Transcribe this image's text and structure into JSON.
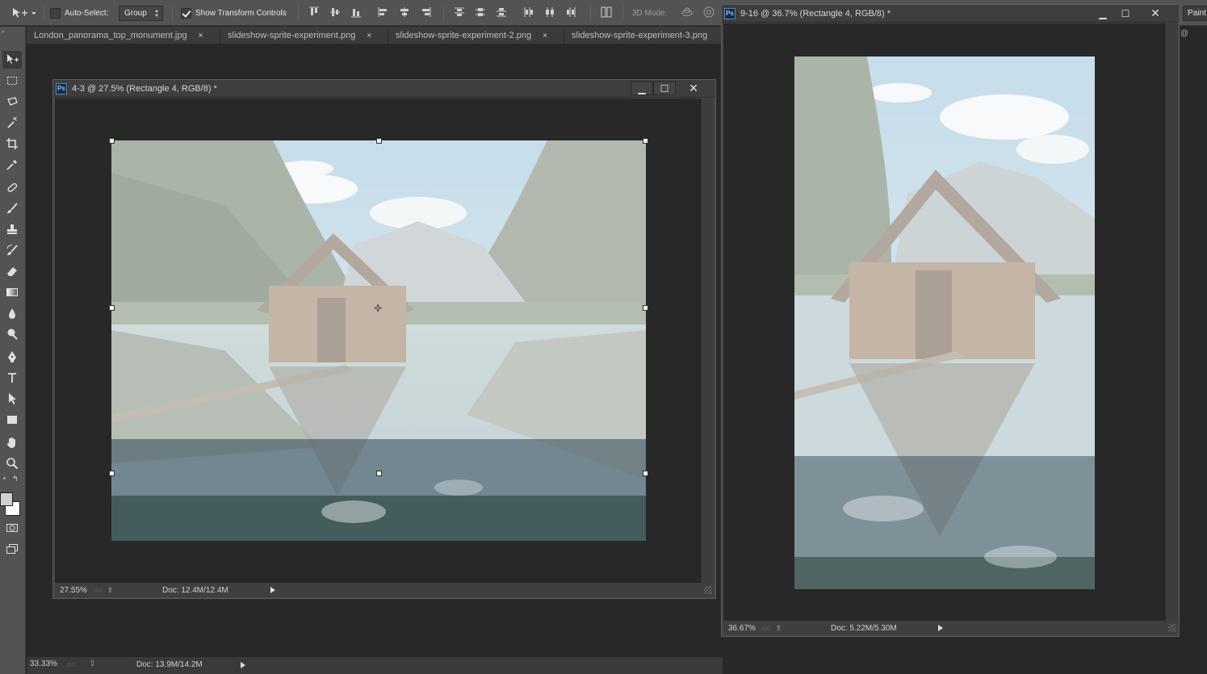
{
  "options_bar": {
    "auto_select_label": "Auto-Select:",
    "auto_select_checked": false,
    "group_select_value": "Group",
    "show_transform_label": "Show Transform Controls",
    "show_transform_checked": true,
    "mode_3d_label": "3D Mode:",
    "workspace_button": "Paint"
  },
  "tabs": [
    {
      "label": "London_panorama_top_monument.jpg",
      "close": "×"
    },
    {
      "label": "slideshow-sprite-experiment.png",
      "close": "×"
    },
    {
      "label": "slideshow-sprite-experiment-2.png",
      "close": "×"
    },
    {
      "label": "slideshow-sprite-experiment-3.png",
      "close": ""
    }
  ],
  "window_43": {
    "ps_badge": "Ps",
    "title": "4-3 @ 27.5% (Rectangle 4, RGB/8) *",
    "zoom": "27.55%",
    "doc_size": "Doc: 12.4M/12.4M"
  },
  "window_916": {
    "ps_badge": "Ps",
    "title": "9-16 @ 36.7% (Rectangle 4, RGB/8) *",
    "zoom": "36.67%",
    "doc_size": "Doc: 5.22M/5.30M"
  },
  "main_status": {
    "zoom": "33.33%",
    "doc_size": "Doc: 13.9M/14.2M"
  },
  "colors": {
    "ui_dark": "#282828",
    "ui_panel": "#535353",
    "foreground_swatch": "#d0d0d0",
    "background_swatch": "#ffffff"
  },
  "icons": [
    "move-tool-icon",
    "marquee-tool-icon",
    "lasso-tool-icon",
    "magic-wand-icon",
    "crop-tool-icon",
    "eyedropper-icon",
    "healing-brush-icon",
    "brush-tool-icon",
    "clone-stamp-icon",
    "history-brush-icon",
    "eraser-icon",
    "gradient-tool-icon",
    "blur-tool-icon",
    "dodge-tool-icon",
    "pen-tool-icon",
    "type-tool-icon",
    "path-selection-icon",
    "rectangle-tool-icon",
    "hand-tool-icon",
    "zoom-tool-icon",
    "quick-mask-icon",
    "screen-mode-icon"
  ]
}
